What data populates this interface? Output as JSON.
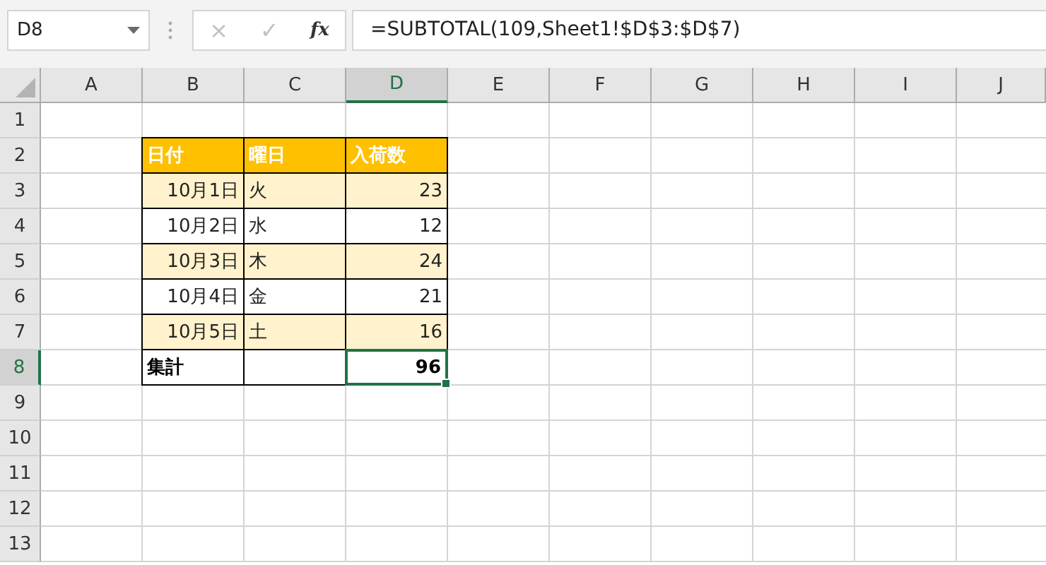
{
  "formula_bar": {
    "name_box": "D8",
    "buttons": [
      {
        "label": "×",
        "disabled": true
      },
      {
        "label": "✓",
        "disabled": true
      },
      {
        "label": "fx",
        "disabled": false
      }
    ],
    "formula": "=SUBTOTAL(109,Sheet1!$D$3:$D$7)"
  },
  "columns": [
    {
      "label": "A",
      "selected": false
    },
    {
      "label": "B",
      "selected": false
    },
    {
      "label": "C",
      "selected": false
    },
    {
      "label": "D",
      "selected": true
    },
    {
      "label": "E",
      "selected": false
    },
    {
      "label": "F",
      "selected": false
    },
    {
      "label": "G",
      "selected": false
    },
    {
      "label": "H",
      "selected": false
    },
    {
      "label": "I",
      "selected": false
    },
    {
      "label": "J",
      "selected": false
    }
  ],
  "rows": [
    {
      "label": "1",
      "selected": false
    },
    {
      "label": "2",
      "selected": false
    },
    {
      "label": "3",
      "selected": false
    },
    {
      "label": "4",
      "selected": false
    },
    {
      "label": "5",
      "selected": false
    },
    {
      "label": "6",
      "selected": false
    },
    {
      "label": "7",
      "selected": false
    },
    {
      "label": "8",
      "selected": true
    },
    {
      "label": "9",
      "selected": false
    },
    {
      "label": "10",
      "selected": false
    },
    {
      "label": "11",
      "selected": false
    },
    {
      "label": "12",
      "selected": false
    },
    {
      "label": "13",
      "selected": false
    }
  ],
  "table": {
    "rows": [
      {
        "kind": "header",
        "cells": [
          {
            "text": "日付",
            "kind": "text",
            "selected": false
          },
          {
            "text": "曜日",
            "kind": "text",
            "selected": false
          },
          {
            "text": "入荷数",
            "kind": "text",
            "selected": false
          }
        ]
      },
      {
        "kind": "band",
        "cells": [
          {
            "text": "10月1日",
            "kind": "number",
            "selected": false
          },
          {
            "text": "火",
            "kind": "text",
            "selected": false
          },
          {
            "text": "23",
            "kind": "number",
            "selected": false
          }
        ]
      },
      {
        "kind": "plain",
        "cells": [
          {
            "text": "10月2日",
            "kind": "number",
            "selected": false
          },
          {
            "text": "水",
            "kind": "text",
            "selected": false
          },
          {
            "text": "12",
            "kind": "number",
            "selected": false
          }
        ]
      },
      {
        "kind": "band",
        "cells": [
          {
            "text": "10月3日",
            "kind": "number",
            "selected": false
          },
          {
            "text": "木",
            "kind": "text",
            "selected": false
          },
          {
            "text": "24",
            "kind": "number",
            "selected": false
          }
        ]
      },
      {
        "kind": "plain",
        "cells": [
          {
            "text": "10月4日",
            "kind": "number",
            "selected": false
          },
          {
            "text": "金",
            "kind": "text",
            "selected": false
          },
          {
            "text": "21",
            "kind": "number",
            "selected": false
          }
        ]
      },
      {
        "kind": "band",
        "cells": [
          {
            "text": "10月5日",
            "kind": "number",
            "selected": false
          },
          {
            "text": "土",
            "kind": "text",
            "selected": false
          },
          {
            "text": "16",
            "kind": "number",
            "selected": false
          }
        ]
      },
      {
        "kind": "total",
        "cells": [
          {
            "text": "集計",
            "kind": "text",
            "selected": false
          },
          {
            "text": "",
            "kind": "text",
            "selected": false
          },
          {
            "text": "96",
            "kind": "number",
            "selected": true
          }
        ]
      }
    ]
  }
}
